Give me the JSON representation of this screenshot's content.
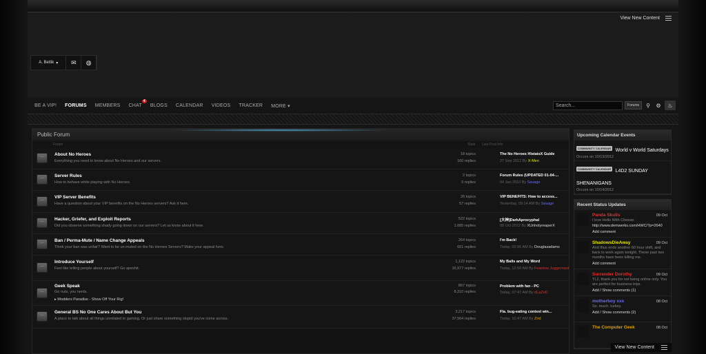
{
  "header": {
    "view_new_content": "View New Content"
  },
  "userbar": {
    "username": "A. Betlik"
  },
  "nav": {
    "items": [
      "BE A VIP!",
      "FORUMS",
      "MEMBERS",
      "CHAT",
      "BLOGS",
      "CALENDAR",
      "VIDEOS",
      "TRACKER",
      "MORE"
    ],
    "chat_badge": "4"
  },
  "search": {
    "placeholder": "Search...",
    "scope": "Forums"
  },
  "forum": {
    "title": "Public Forum",
    "col_forum": "Forum",
    "col_stats": "Stats",
    "col_last": "Last Post Info",
    "rows": [
      {
        "title": "About No Heroes",
        "desc": "Everything you need to know about No Heroes and our servers.",
        "topics": "18 topics",
        "replies": "160 replies",
        "lp_title": "The No Heroes HlstatsX Guide",
        "lp_date": "27 Sep 2012",
        "lp_by": "By",
        "lp_user": "X-Men",
        "lp_color": "#e6e600"
      },
      {
        "title": "Server Rules",
        "desc": "How to behave while playing with No Heroes.",
        "topics": "2 topics",
        "replies": "0 replies",
        "lp_title": "Forum Rules (UPDATED 01-04-...",
        "lp_date": "04 Jan 2010",
        "lp_by": "By",
        "lp_user": "Savage",
        "lp_color": "#6a6aff"
      },
      {
        "title": "VIP Server Benefits",
        "desc": "Have a question about your VIP benefits on the No Heroes servers? Ask it here.",
        "topics": "26 topics",
        "replies": "57 replies",
        "lp_title": "VIP BENEFITS: How to access...",
        "lp_date": "Yesterday, 09:14 AM",
        "lp_by": "By",
        "lp_user": "Savage",
        "lp_color": "#6a6aff"
      },
      {
        "title": "Hacker, Griefer, and Exploit Reports",
        "desc": "Did you observe something shady going down on our servers? Let us know about it here.",
        "topics": "522 topics",
        "replies": "1,685 replies",
        "lp_title": "[大神]DarkAprocyphal",
        "lp_date": "08 Oct 2012",
        "lp_by": "By",
        "lp_user": "XUnholyreaperX",
        "lp_color": "#dddddd"
      },
      {
        "title": "Ban / Perma-Mute / Name Change Appeals",
        "desc": "Think your ban was unfair? Want to be un-muted on the No Heroes Servers? Make your appeal here.",
        "topics": "264 topics",
        "replies": "601 replies",
        "lp_title": "I'm Back!",
        "lp_date": "Today, 02:06 AM",
        "lp_by": "By",
        "lp_user": "Douglasadams",
        "lp_color": "#dddddd"
      },
      {
        "title": "Introduce Yourself",
        "desc": "Feel like telling people about yourself? Go apeshit.",
        "topics": "1,122 topics",
        "replies": "16,977 replies",
        "lp_title": "My Balls and My Word",
        "lp_date": "Today, 12:59 AM",
        "lp_by": "By",
        "lp_user": "Fearless Juggernaut",
        "lp_color": "#e03030"
      },
      {
        "title": "Geek Speak",
        "desc": "Go nuts, you nerds.",
        "sub": "Modders Paradise - Show Off Your Rig!",
        "topics": "867 topics",
        "replies": "8,310 replies",
        "lp_title": "Problem with fan - PC",
        "lp_date": "Today, 07:47 AM",
        "lp_by": "By",
        "lp_user": "dLaZeD",
        "lp_color": "#e03030"
      },
      {
        "title": "General BS No One Cares About But You",
        "desc": "A place to talk about all things unrelated to gaming. Or just share something stupid you've come across.",
        "topics": "3,217 topics",
        "replies": "37,564 replies",
        "lp_title": "Fla. bug-eating contest win...",
        "lp_date": "Today, 10:47 AM",
        "lp_by": "By",
        "lp_user": "Zird",
        "lp_color": "#e6a000"
      }
    ]
  },
  "calendar": {
    "title": "Upcoming Calendar Events",
    "tag": "COMMUNITY CALENDAR",
    "events": [
      {
        "title": "World v World Saturdays",
        "date": "Occurs on 10/13/2012"
      },
      {
        "title": "L4D2 SUNDAY SHENANIGANS",
        "date": "Occurs on 10/14/2012"
      }
    ]
  },
  "statuses": {
    "title": "Recent Status Updates",
    "items": [
      {
        "name": "Panda Skulls",
        "color": "#e03030",
        "date": "09 Oct",
        "text": "I love Hello With Cheese:",
        "link": "http://www.demwerks.com/HWC/?p=2640",
        "action": "Add comment"
      },
      {
        "name": "ShadowsDieAway",
        "color": "#e6e600",
        "date": "09 Oct",
        "text": "And thus ends another 60 hour shift, and back to work again tonight. These past two months have been killing me.",
        "action": "Add comment"
      },
      {
        "name": "Surrender Dorothy",
        "color": "#e03030",
        "date": "09 Oct",
        "text": "TL2, thank you for not being online only. You are perfect for business trips.",
        "action": "Add / Show comments (1)"
      },
      {
        "name": "motherboy xxx",
        "color": "#6a6aff",
        "date": "08 Oct",
        "text": "So. much. turkey.",
        "action": "Add / Show comments (2)"
      },
      {
        "name": "The Computer Geek",
        "color": "#e6a000",
        "date": "08 Oct",
        "text": "",
        "action": ""
      }
    ]
  },
  "footer": {
    "view_new_content": "View New Content"
  }
}
